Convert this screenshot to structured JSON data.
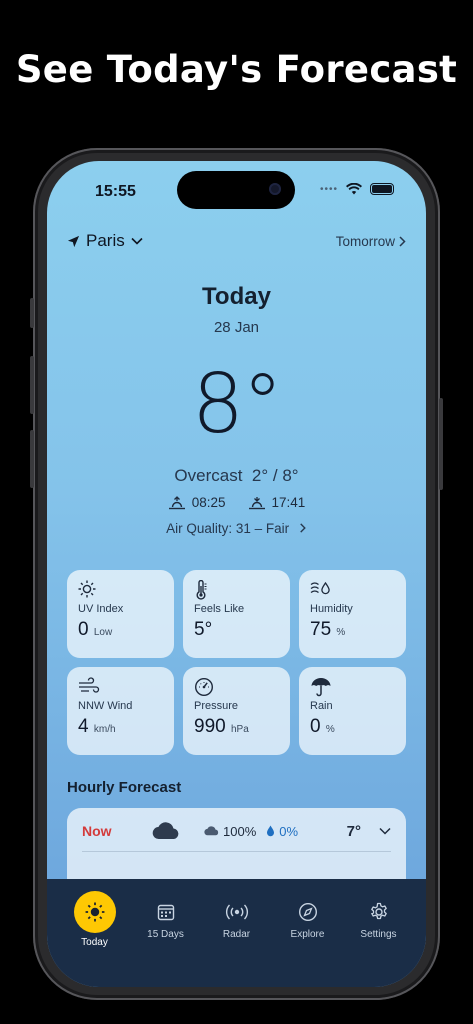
{
  "headline": "See Today's Forecast",
  "status": {
    "time": "15:55"
  },
  "location": {
    "city": "Paris"
  },
  "nav": {
    "tomorrow_label": "Tomorrow"
  },
  "day": {
    "title": "Today",
    "date": "28 Jan"
  },
  "current": {
    "temperature": "8°",
    "condition": "Overcast",
    "range": "2° / 8°",
    "sunrise": "08:25",
    "sunset": "17:41",
    "air_quality": "Air Quality: 31 – Fair"
  },
  "details": [
    {
      "label": "UV Index",
      "value": "0",
      "unit": "Low",
      "icon": "sun-icon"
    },
    {
      "label": "Feels Like",
      "value": "5°",
      "unit": "",
      "icon": "thermometer-icon"
    },
    {
      "label": "Humidity",
      "value": "75",
      "unit": "%",
      "icon": "humidity-icon"
    },
    {
      "label": "NNW Wind",
      "value": "4",
      "unit": "km/h",
      "icon": "wind-icon"
    },
    {
      "label": "Pressure",
      "value": "990",
      "unit": "hPa",
      "icon": "gauge-icon"
    },
    {
      "label": "Rain",
      "value": "0",
      "unit": "%",
      "icon": "umbrella-icon"
    }
  ],
  "hourly": {
    "title": "Hourly Forecast",
    "rows": [
      {
        "time": "Now",
        "cloud": "100%",
        "precip": "0%",
        "temp": "7°"
      }
    ]
  },
  "tabs": [
    {
      "label": "Today",
      "icon": "sun-icon"
    },
    {
      "label": "15 Days",
      "icon": "calendar-icon"
    },
    {
      "label": "Radar",
      "icon": "radar-icon"
    },
    {
      "label": "Explore",
      "icon": "compass-icon"
    },
    {
      "label": "Settings",
      "icon": "gear-icon"
    }
  ],
  "colors": {
    "accent": "#fec803",
    "now": "#d33b3b",
    "tabbar": "#1a2d47"
  }
}
